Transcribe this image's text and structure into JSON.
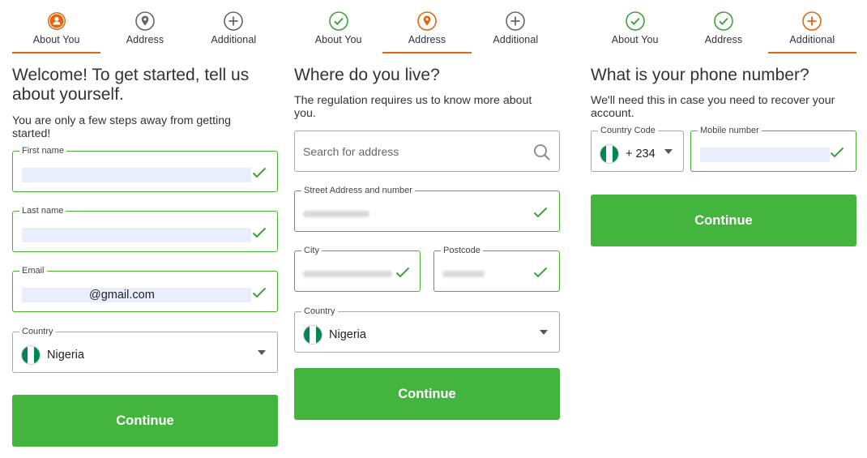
{
  "colors": {
    "accent": "#e2650f",
    "success": "#43b53e",
    "check": "#4caf2e",
    "inactive": "#666666"
  },
  "steps": {
    "about": "About You",
    "address": "Address",
    "additional": "Additional"
  },
  "screen1": {
    "heading": "Welcome! To get started, tell us about yourself.",
    "subtitle": "You are only a few steps away from getting started!",
    "first_name_label": "First name",
    "last_name_label": "Last name",
    "email_label": "Email",
    "email_value": "@gmail.com",
    "country_label": "Country",
    "country_value": "Nigeria",
    "continue": "Continue"
  },
  "screen2": {
    "heading": "Where do you live?",
    "subtitle": "The regulation requires us to know more about you.",
    "search_placeholder": "Search for address",
    "street_label": "Street Address and number",
    "city_label": "City",
    "postcode_label": "Postcode",
    "country_label": "Country",
    "country_value": "Nigeria",
    "continue": "Continue"
  },
  "screen3": {
    "heading": "What is your phone number?",
    "subtitle": "We'll need this in case you need to recover your account.",
    "country_code_label": "Country Code",
    "country_code_value": "+ 234",
    "mobile_label": "Mobile number",
    "continue": "Continue"
  }
}
